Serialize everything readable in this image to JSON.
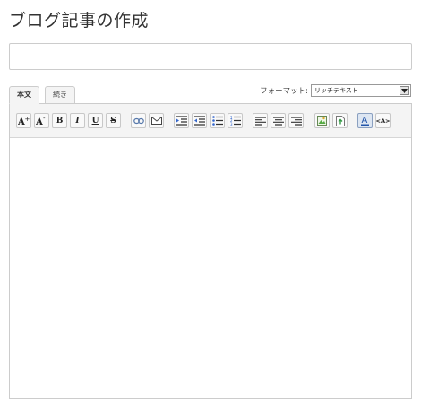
{
  "page": {
    "title": "ブログ記事の作成"
  },
  "title_input": {
    "value": "",
    "placeholder": ""
  },
  "tabs": [
    {
      "label": "本文",
      "active": true
    },
    {
      "label": "続き",
      "active": false
    }
  ],
  "format": {
    "label": "フォーマット:",
    "selected": "リッチテキスト"
  },
  "toolbar": {
    "buttons": [
      {
        "name": "font-size-increase-icon",
        "glyph": "A+"
      },
      {
        "name": "font-size-decrease-icon",
        "glyph": "A-"
      },
      {
        "name": "bold-icon",
        "glyph": "B"
      },
      {
        "name": "italic-icon",
        "glyph": "I"
      },
      {
        "name": "underline-icon",
        "glyph": "U"
      },
      {
        "name": "strikethrough-icon",
        "glyph": "S"
      },
      {
        "name": "link-icon",
        "glyph": ""
      },
      {
        "name": "email-icon",
        "glyph": ""
      },
      {
        "name": "indent-icon",
        "glyph": ""
      },
      {
        "name": "outdent-icon",
        "glyph": ""
      },
      {
        "name": "bullet-list-icon",
        "glyph": ""
      },
      {
        "name": "numbered-list-icon",
        "glyph": ""
      },
      {
        "name": "align-left-icon",
        "glyph": ""
      },
      {
        "name": "align-center-icon",
        "glyph": ""
      },
      {
        "name": "align-right-icon",
        "glyph": ""
      },
      {
        "name": "insert-image-icon",
        "glyph": ""
      },
      {
        "name": "upload-file-icon",
        "glyph": ""
      },
      {
        "name": "text-color-icon",
        "glyph": "A"
      },
      {
        "name": "html-source-icon",
        "glyph": "<A>"
      }
    ]
  },
  "colors": {
    "border": "#cccccc",
    "toolbar_bg": "#f4f4f4",
    "active_button_bg": "#dde6f2"
  }
}
